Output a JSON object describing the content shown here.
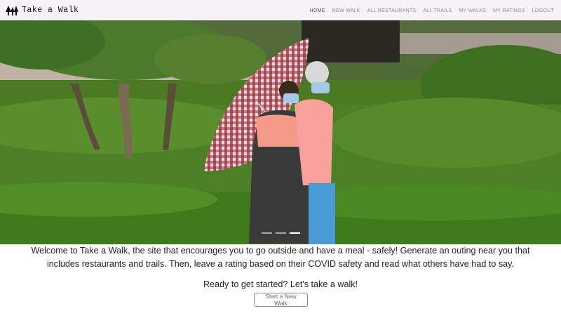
{
  "brand": {
    "name": "Take a Walk",
    "icon": "trees-icon"
  },
  "nav": {
    "items": [
      {
        "label": "HOME",
        "active": true
      },
      {
        "label": "NEW WALK",
        "active": false
      },
      {
        "label": "ALL RESTAURANTS",
        "active": false
      },
      {
        "label": "ALL TRAILS",
        "active": false
      },
      {
        "label": "MY WALKS",
        "active": false
      },
      {
        "label": "MY RATINGS",
        "active": false
      },
      {
        "label": "LOGOUT",
        "active": false
      }
    ]
  },
  "carousel": {
    "slide_count": 3,
    "active_index": 2
  },
  "intro": {
    "welcome": "Welcome to Take a Walk, the site that encourages you to go outside and have a meal - safely! Generate an outing near you that includes restaurants and trails. Then, leave a rating based on their COVID safety and read what others have had to say.",
    "cta_text": "Ready to get started? Let's take a walk!",
    "cta_button": "Start a New Walk"
  },
  "colors": {
    "navbar_bg": "#f5f3f6",
    "foliage": "#3d6a1c",
    "button_border": "#8a8a8a"
  }
}
